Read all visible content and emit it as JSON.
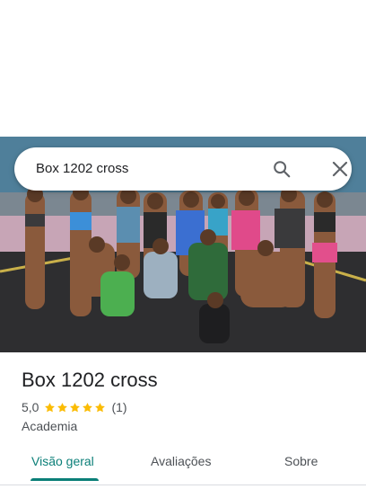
{
  "search": {
    "query": "Box 1202 cross"
  },
  "place": {
    "title": "Box 1202 cross",
    "rating": "5,0",
    "stars": 5,
    "review_count": "(1)",
    "category": "Academia"
  },
  "tabs": [
    {
      "label": "Visão geral",
      "active": true
    },
    {
      "label": "Avaliações",
      "active": false
    },
    {
      "label": "Sobre",
      "active": false
    }
  ],
  "colors": {
    "accent": "#0b7f78",
    "star": "#fbbc04",
    "text_primary": "#202124",
    "text_secondary": "#4d5156"
  },
  "icons": {
    "search": "search-icon",
    "close": "close-icon",
    "star": "star-icon"
  }
}
